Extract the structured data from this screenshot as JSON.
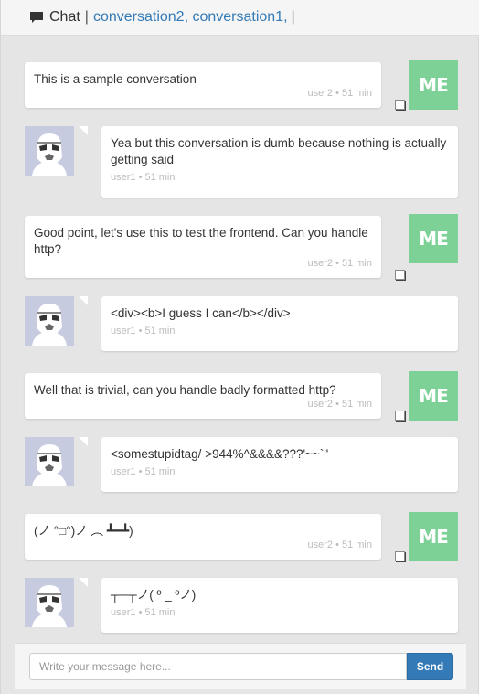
{
  "header": {
    "title": "Chat",
    "separator": "|",
    "conversations": "conversation2, conversation1,",
    "trailing": "|",
    "icon": "chat-bubble-icon"
  },
  "me_avatar_label": "ME",
  "messages": [
    {
      "side": "me",
      "text": "This is a sample conversation",
      "meta": "user2 • 51 min"
    },
    {
      "side": "them",
      "text": "Yea but this conversation is dumb because nothing is actually getting said",
      "meta": "user1 • 51 min"
    },
    {
      "side": "me",
      "text": "Good point, let's use this to test the frontend. Can you handle http?",
      "meta": "user2 • 51 min"
    },
    {
      "side": "them",
      "text": "<div><b>I guess I can</b></div>",
      "meta": "user1 • 51 min"
    },
    {
      "side": "me",
      "text": "Well that is trivial, can you handle badly formatted http?",
      "meta": "user2 • 51 min"
    },
    {
      "side": "them",
      "text": "<somestupidtag/ >944%^&&&&???'~~`\"",
      "meta": "user1 • 51 min"
    },
    {
      "side": "me",
      "text": "(ノ °□°)ノ ︵ ┻━┻)",
      "meta": "user2 • 51 min"
    },
    {
      "side": "them",
      "text": "┬─┬ノ( º _ ºノ)",
      "meta": "user1 • 51 min"
    }
  ],
  "composer": {
    "placeholder": "Write your message here...",
    "send_label": "Send"
  },
  "colors": {
    "me_avatar": "#7dd197",
    "send_button": "#337ab7",
    "link": "#337ab7"
  }
}
